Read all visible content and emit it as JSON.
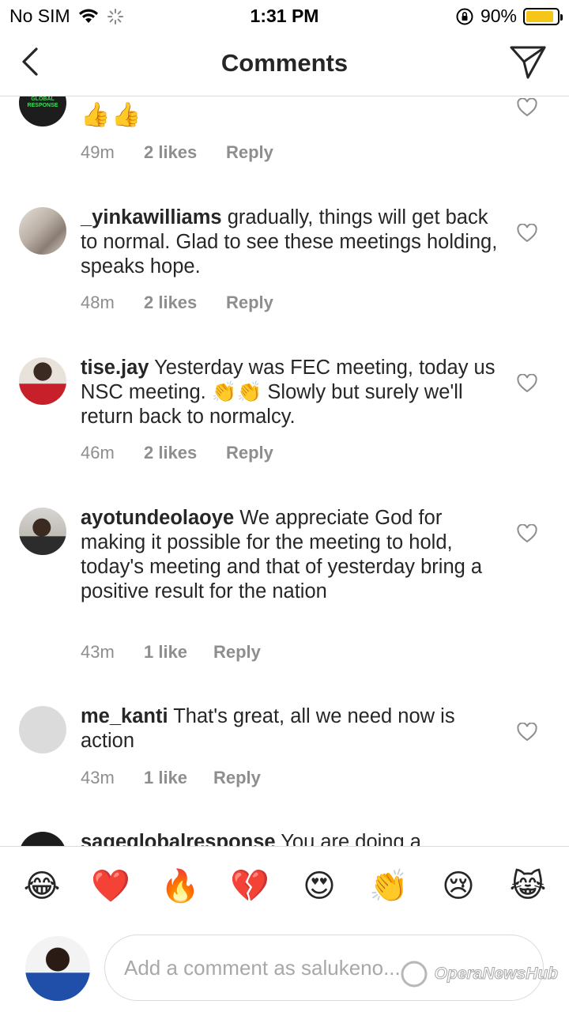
{
  "status_bar": {
    "carrier": "No SIM",
    "time": "1:31 PM",
    "battery_percent": "90%",
    "battery_level": 0.9,
    "battery_color": "#f5c518"
  },
  "header": {
    "title": "Comments",
    "back_icon": "chevron-left-icon",
    "share_icon": "paper-plane-icon"
  },
  "comments": [
    {
      "username": "",
      "text": "👍👍",
      "time": "49m",
      "likes": "2 likes",
      "reply": "Reply",
      "avatar_text": "GLOBAL RESPONSE"
    },
    {
      "username": "_yinkawilliams",
      "text": "gradually, things will get back to normal. Glad to see these meetings holding, speaks hope.",
      "time": "48m",
      "likes": "2 likes",
      "reply": "Reply"
    },
    {
      "username": "tise.jay",
      "text": "Yesterday was FEC meeting, today us NSC meeting. 👏👏 Slowly but surely we'll return back to normalcy.",
      "time": "46m",
      "likes": "2 likes",
      "reply": "Reply"
    },
    {
      "username": "ayotundeolaoye",
      "text": "We appreciate God for making it possible for the meeting to hold, today's meeting and that of yesterday bring a positive result for the nation",
      "time": "43m",
      "likes": "1 like",
      "reply": "Reply"
    },
    {
      "username": "me_kanti",
      "text": "That's great, all we need now is action",
      "time": "43m",
      "likes": "1 like",
      "reply": "Reply"
    },
    {
      "username": "sageglobalresponse",
      "text": "You are doing a"
    }
  ],
  "emoji_bar": [
    "😂",
    "❤️",
    "🔥",
    "💔",
    "😍",
    "👏",
    "😢",
    "😹"
  ],
  "composer": {
    "placeholder": "Add a comment as salukeno..."
  },
  "watermark": "OperaNewsHub"
}
